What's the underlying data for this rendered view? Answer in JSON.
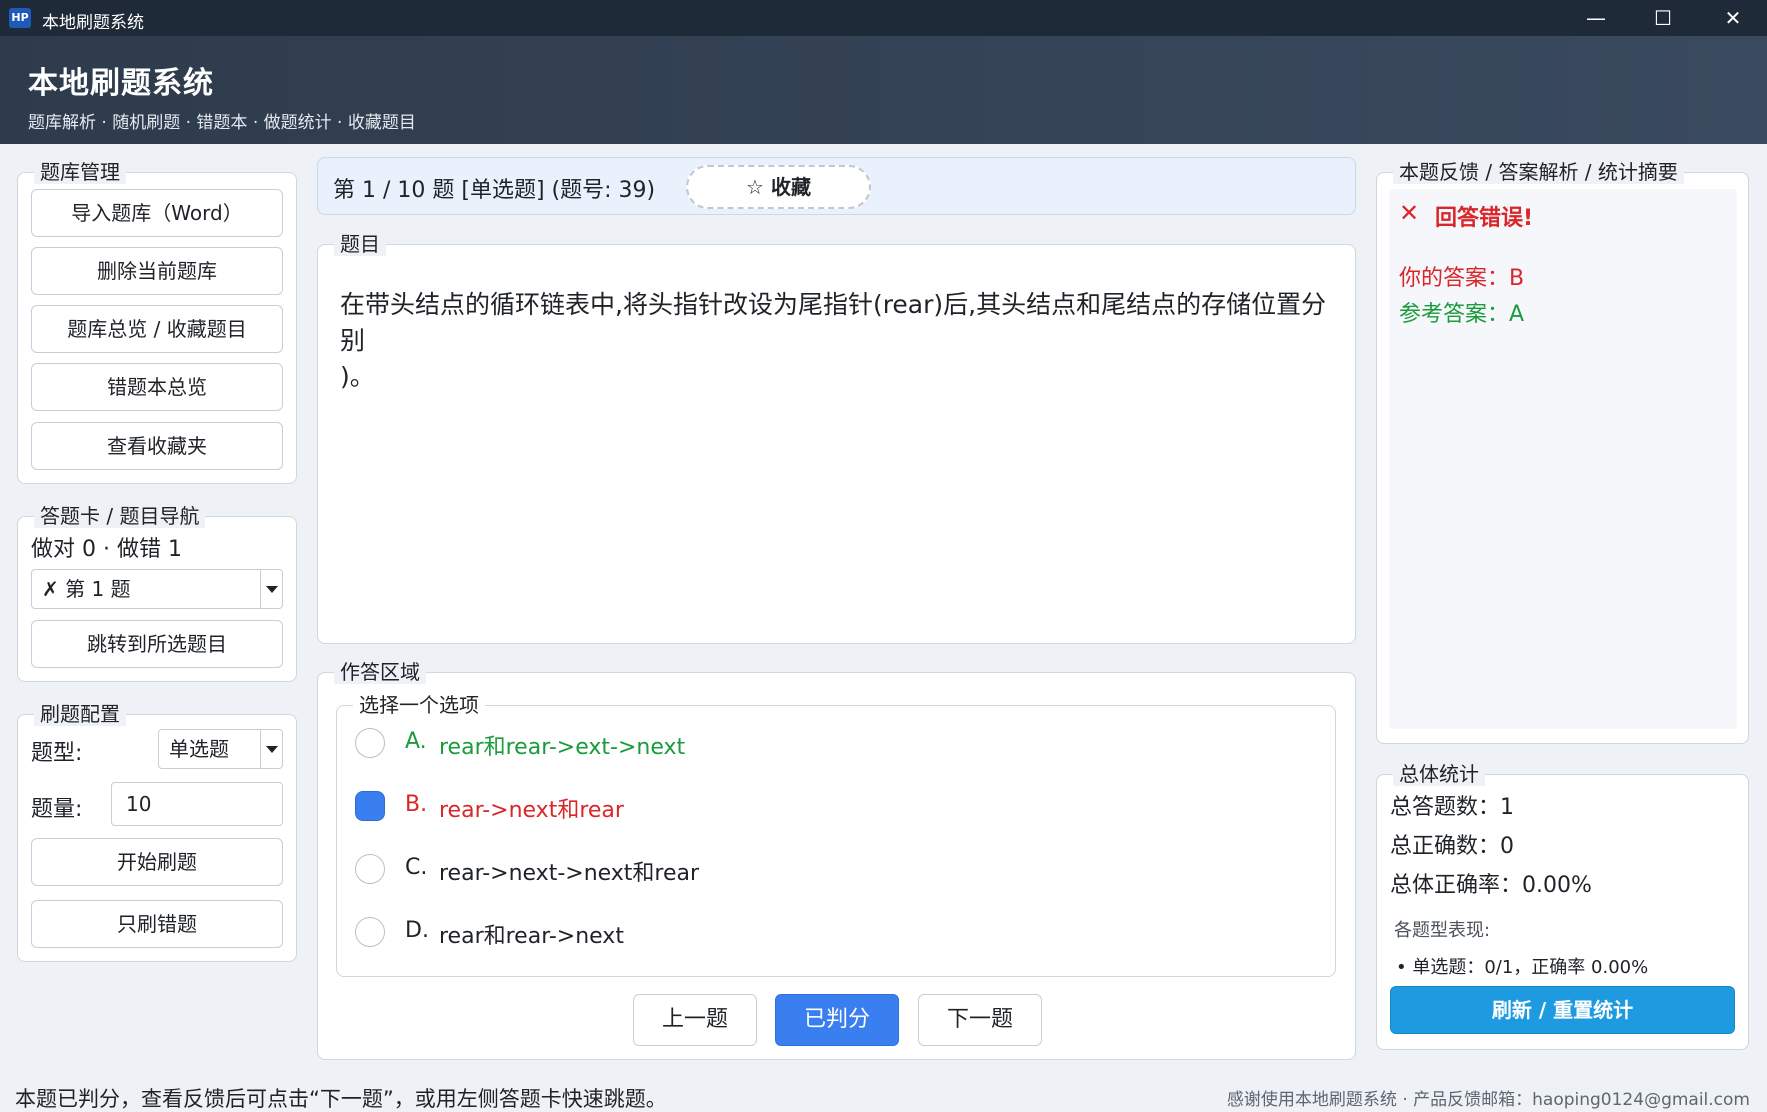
{
  "window": {
    "icon_text": "HP",
    "title": "本地刷题系统",
    "minimize_glyph": "—",
    "maximize_glyph": "☐",
    "close_glyph": "✕"
  },
  "header": {
    "title": "本地刷题系统",
    "subtitle": "题库解析 · 随机刷题 · 错题本 · 做题统计 · 收藏题目"
  },
  "bank": {
    "title": "题库管理",
    "buttons": [
      "导入题库（Word）",
      "删除当前题库",
      "题库总览 / 收藏题目",
      "错题本总览",
      "查看收藏夹"
    ]
  },
  "card": {
    "title": "答题卡 / 题目导航",
    "summary": "做对 0 · 做错 1",
    "selected": "✗ 第 1 题",
    "jump_label": "跳转到所选题目"
  },
  "config": {
    "title": "刷题配置",
    "type_label": "题型:",
    "type_value": "单选题",
    "count_label": "题量:",
    "count_value": "10",
    "start_label": "开始刷题",
    "wrong_only_label": "只刷错题"
  },
  "question": {
    "header": "第 1 / 10 题  [单选题]  (题号: 39)",
    "favorite_label": "☆ 收藏",
    "section_title": "题目",
    "text": "在带头结点的循环链表中,将头指针改设为尾指针(rear)后,其头结点和尾结点的存储位置分别\n)。"
  },
  "answer": {
    "section_title": "作答区域",
    "group_title": "选择一个选项",
    "options": [
      {
        "letter": "A.",
        "text": "rear和rear->ext->next",
        "state": "correct",
        "color": "#1a9b3c"
      },
      {
        "letter": "B.",
        "text": "rear->next和rear",
        "state": "selected-wrong",
        "color": "#d9262b"
      },
      {
        "letter": "C.",
        "text": "rear->next->next和rear",
        "state": "normal",
        "color": "#1f2328"
      },
      {
        "letter": "D.",
        "text": "rear和rear->next",
        "state": "normal",
        "color": "#1f2328"
      }
    ],
    "prev_label": "上一题",
    "judged_label": "已判分",
    "next_label": "下一题"
  },
  "feedback": {
    "title": "本题反馈 / 答案解析 / 统计摘要",
    "result_icon": "✕",
    "result": "回答错误!",
    "your_answer": "你的答案：B",
    "reference_answer": "参考答案：A"
  },
  "stats": {
    "title": "总体统计",
    "total": "总答题数：1",
    "correct": "总正确数：0",
    "rate": "总体正确率：0.00%",
    "by_type_title": "各题型表现:",
    "by_type_line": "• 单选题：0/1，正确率 0.00%",
    "refresh_label": "刷新 / 重置统计"
  },
  "statusbar": {
    "left": "本题已判分，查看反馈后可点击“下一题”，或用左侧答题卡快速跳题。",
    "right": "感谢使用本地刷题系统 · 产品反馈邮箱：haoping0124@gmail.com"
  },
  "colors": {
    "accent": "#3a7ff0",
    "correct": "#1a9b3c",
    "wrong": "#d9262b",
    "refresh": "#1e9be0"
  }
}
